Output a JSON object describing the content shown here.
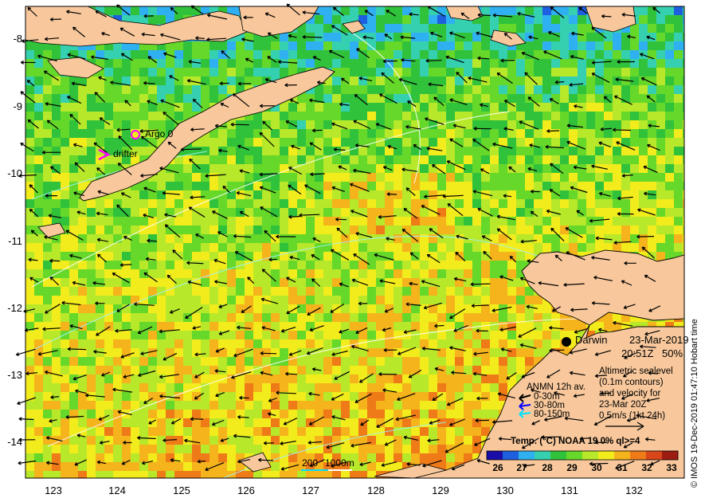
{
  "axes": {
    "lat_ticks": [
      "-8",
      "-9",
      "-10",
      "-11",
      "-12",
      "-13",
      "-14"
    ],
    "lon_ticks": [
      "123",
      "124",
      "125",
      "126",
      "127",
      "128",
      "129",
      "130",
      "131",
      "132"
    ]
  },
  "credit": "© IMOS 19-Dec-2019 01:47:10 Hobart time",
  "markers": {
    "argo_label": "Argo 0",
    "drifter_label": "drifter",
    "argo_color": "#ff00ff",
    "drifter_color": "#ff00ff"
  },
  "place": {
    "name": "Darwin",
    "date": "23-Mar-2019",
    "time": "20:51Z",
    "coverage": "50%"
  },
  "sealevel_note": {
    "line1": "Altimetric sealevel",
    "line2": "(0.1m contours)",
    "line3": "and velocity for",
    "line4": "23-Mar 20Z",
    "line5": "0.5m/s (1kt 24h)"
  },
  "anmn": {
    "title": "ANMN 12h av.",
    "items": [
      {
        "label": "0-30m",
        "color": "#000000"
      },
      {
        "label": "30-80m",
        "color": "#0000ff"
      },
      {
        "label": "80-150m",
        "color": "#00e0ff"
      }
    ]
  },
  "colorbar": {
    "title": "Temp. (°C) NOAA 19 0% ql>=4",
    "labels": [
      "26",
      "27",
      "28",
      "29",
      "30",
      "31",
      "32",
      "33"
    ],
    "colors": [
      "#1a0da8",
      "#1e5fe0",
      "#2fb0f0",
      "#35d0b0",
      "#31c23c",
      "#66d82a",
      "#b8e82a",
      "#f2ec1c",
      "#f5b31c",
      "#ee7a18",
      "#d9461a",
      "#9c1c12"
    ]
  },
  "scale_bar": {
    "label_a": "200",
    "label_b": "1000m"
  },
  "colors": {
    "land": "#f8c89c",
    "contour": "#ffffff",
    "vector": "#000000"
  }
}
